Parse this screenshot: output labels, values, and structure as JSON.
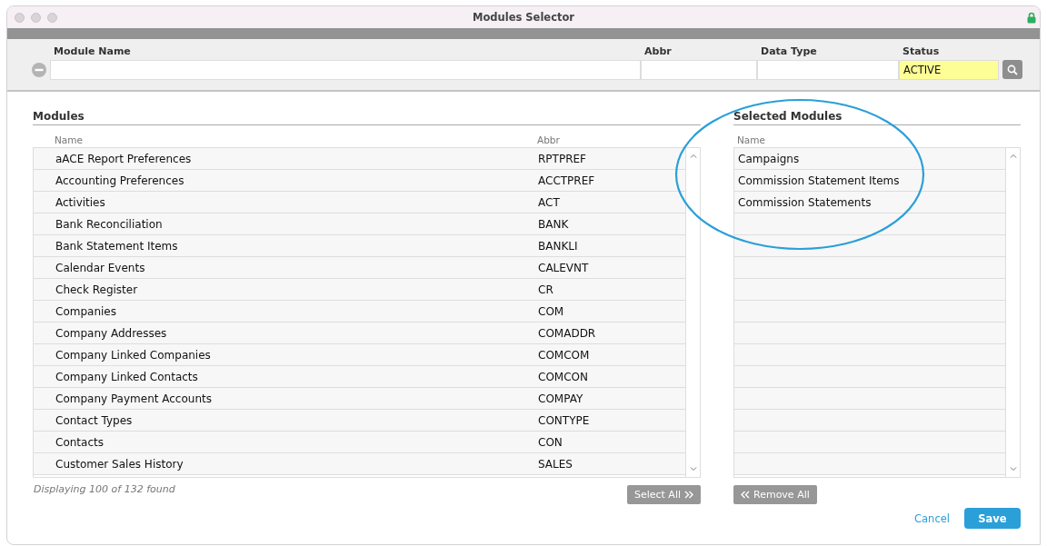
{
  "window": {
    "title": "Modules Selector"
  },
  "filters": [
    {
      "label": "Module Name",
      "highlighted": false
    },
    {
      "label": "Abbr",
      "highlighted": false
    },
    {
      "label": "Data Type",
      "highlighted": false
    },
    {
      "label": "Status",
      "value": "ACTIVE",
      "highlighted": true
    }
  ],
  "modules": {
    "title": "Modules",
    "columns": [
      "Name",
      "Abbr"
    ],
    "rows": [
      {
        "name": "aACE Report Preferences",
        "abbr": "RPTPREF"
      },
      {
        "name": "Accounting Preferences",
        "abbr": "ACCTPREF"
      },
      {
        "name": "Activities",
        "abbr": "ACT"
      },
      {
        "name": "Bank Reconciliation",
        "abbr": "BANK"
      },
      {
        "name": "Bank Statement Items",
        "abbr": "BANKLI"
      },
      {
        "name": "Calendar Events",
        "abbr": "CALEVNT"
      },
      {
        "name": "Check Register",
        "abbr": "CR"
      },
      {
        "name": "Companies",
        "abbr": "COM"
      },
      {
        "name": "Company Addresses",
        "abbr": "COMADDR"
      },
      {
        "name": "Company Linked Companies",
        "abbr": "COMCOM"
      },
      {
        "name": "Company Linked Contacts",
        "abbr": "COMCON"
      },
      {
        "name": "Company Payment Accounts",
        "abbr": "COMPAY"
      },
      {
        "name": "Contact Types",
        "abbr": "CONTYPE"
      },
      {
        "name": "Contacts",
        "abbr": "CON"
      },
      {
        "name": "Customer Sales History",
        "abbr": "SALES"
      }
    ],
    "footer": "Displaying 100 of 132 found",
    "button": "Select All"
  },
  "selected": {
    "title": "Selected Modules",
    "columns": [
      "Name"
    ],
    "rows": [
      {
        "name": "Campaigns"
      },
      {
        "name": "Commission Statement Items"
      },
      {
        "name": "Commission Statements"
      }
    ],
    "button": "Remove All"
  },
  "buttons": {
    "cancel": "Cancel",
    "save": "Save"
  }
}
